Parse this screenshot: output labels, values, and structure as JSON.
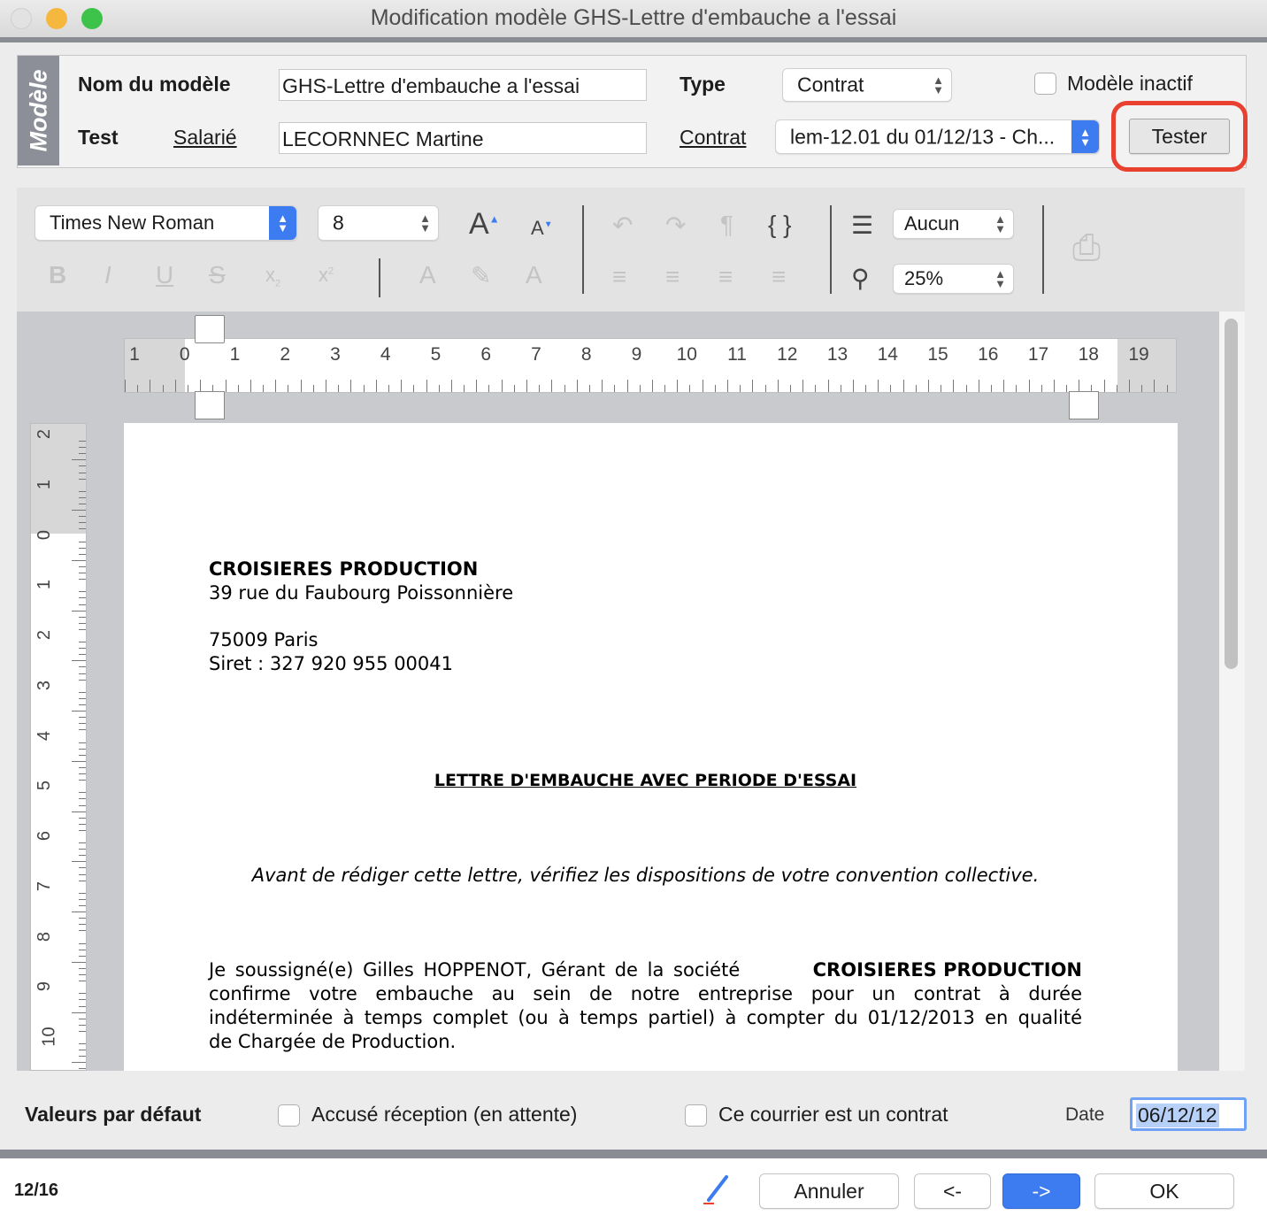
{
  "window": {
    "title": "Modification modèle GHS-Lettre d'embauche a l'essai"
  },
  "header": {
    "side_tab": "Modèle",
    "name_label": "Nom du modèle",
    "name_value": "GHS-Lettre d'embauche a l'essai",
    "type_label": "Type",
    "type_value": "Contrat",
    "inactive_label": "Modèle inactif",
    "test_label": "Test",
    "employee_link": "Salarié",
    "employee_value": "LECORNNEC Martine",
    "contract_link": "Contrat",
    "contract_value": "lem-12.01 du 01/12/13 - Ch...",
    "test_button": "Tester"
  },
  "toolbar": {
    "font": "Times New Roman",
    "size": "8",
    "list_style": "Aucun",
    "zoom": "25%",
    "braces": "{ }"
  },
  "ruler": {
    "h_ticks": [
      "1",
      "0",
      "1",
      "2",
      "3",
      "4",
      "5",
      "6",
      "7",
      "8",
      "9",
      "10",
      "11",
      "12",
      "13",
      "14",
      "15",
      "16",
      "17",
      "18",
      "19"
    ],
    "v_ticks": [
      "2",
      "1",
      "0",
      "1",
      "2",
      "3",
      "4",
      "5",
      "6",
      "7",
      "8",
      "9",
      "10"
    ]
  },
  "document": {
    "company": "CROISIERES PRODUCTION",
    "address1": "39 rue du Faubourg Poissonnière",
    "address2": "75009 Paris",
    "siret": "Siret : 327 920 955 00041",
    "heading": "LETTRE D'EMBAUCHE AVEC PERIODE D'ESSAI",
    "note": "Avant de rédiger cette lettre, vérifiez les dispositions de votre convention collective.",
    "body_lines": [
      "Je soussigné(e) Gilles HOPPENOT, Gérant de la société",
      "CROISIERES PRODUCTION",
      "confirme votre embauche au sein de notre entreprise pour un contrat à durée",
      "indéterminée à temps complet (ou à temps partiel) à compter du 01/12/2013 en qualité",
      "de Chargée de Production."
    ]
  },
  "defaults": {
    "label": "Valeurs par défaut",
    "ack_label": "Accusé réception (en attente)",
    "contract_label": "Ce courrier est un contrat",
    "date_label": "Date",
    "date_value": "06/12/12"
  },
  "footer": {
    "counter": "12/16",
    "cancel": "Annuler",
    "prev": "<-",
    "next": "->",
    "ok": "OK"
  },
  "colors": {
    "accent": "#3d7cf0",
    "highlight": "#e8412f"
  }
}
